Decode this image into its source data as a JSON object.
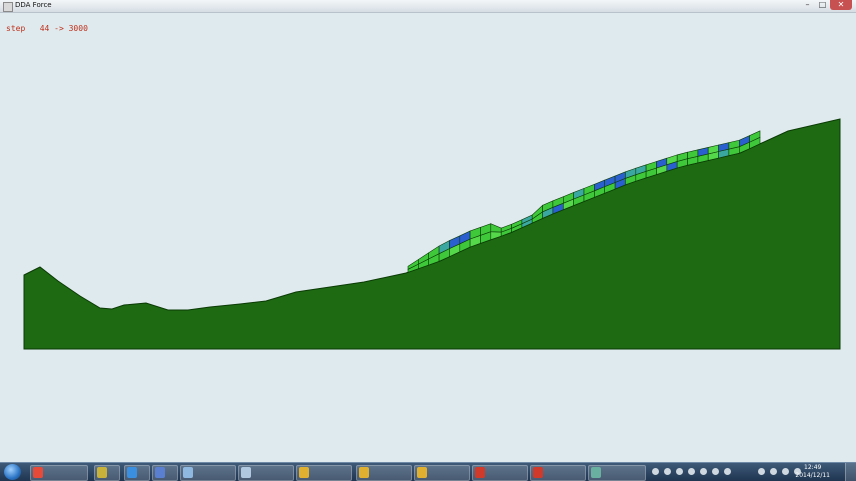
{
  "window": {
    "title": "DDA Force",
    "minimize_glyph": "–",
    "maximize_glyph": "□",
    "close_glyph": "✕"
  },
  "status": {
    "step_label": "step   44 -> 3000"
  },
  "colors": {
    "background": "#dfeaee",
    "terrain": "#1d6a12",
    "block_green": "#3ec83a",
    "block_blue": "#2a5fd0",
    "block_teal": "#3aa8a0",
    "step_text": "#c0301a"
  },
  "taskbar": {
    "start_icon": "windows-orb-icon",
    "pinned": [
      {
        "name": "chrome-icon"
      },
      {
        "name": "app-icon-1"
      },
      {
        "name": "app-icon-2"
      },
      {
        "name": "app-icon-3"
      },
      {
        "name": "app-icon-4"
      },
      {
        "name": "explorer-icon"
      },
      {
        "name": "folder-icon-1"
      },
      {
        "name": "folder-icon-2"
      },
      {
        "name": "folder-icon-3"
      },
      {
        "name": "pdf-icon-1"
      },
      {
        "name": "pdf-icon-2"
      },
      {
        "name": "window-icon"
      }
    ],
    "clock_time": "12:49",
    "clock_date": "2014/12/11"
  }
}
